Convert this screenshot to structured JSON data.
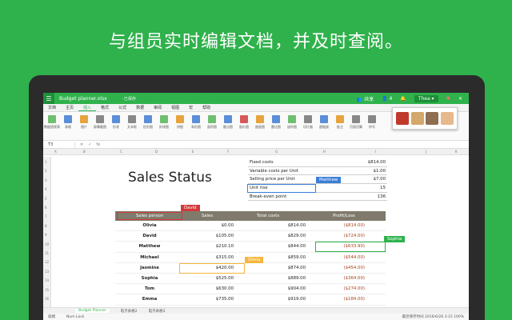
{
  "headline": "与组员实时编辑文档，并及时查阅。",
  "titlebar": {
    "file_name": "Budget planner.xlsx",
    "status": "· 已保存",
    "share": "共享",
    "users": "4",
    "user_name": "Thea ▾"
  },
  "menu": [
    "文档",
    "主页",
    "插入",
    "格式",
    "公式",
    "数据",
    "审阅",
    "视图",
    "宏",
    "帮助"
  ],
  "ribbon": [
    {
      "label": "数据透视表",
      "color": "g"
    },
    {
      "label": "表格",
      "color": "b"
    },
    {
      "label": "图片",
      "color": "o"
    },
    {
      "label": "屏幕截图",
      "color": "k"
    },
    {
      "label": "形状",
      "color": "b"
    },
    {
      "label": "文本框",
      "color": "k"
    },
    {
      "label": "柱形图",
      "color": "b"
    },
    {
      "label": "折线图",
      "color": "g"
    },
    {
      "label": "饼图",
      "color": "o"
    },
    {
      "label": "条形图",
      "color": "b"
    },
    {
      "label": "面积图",
      "color": "g"
    },
    {
      "label": "散点图",
      "color": "b"
    },
    {
      "label": "股价图",
      "color": "r"
    },
    {
      "label": "曲面图",
      "color": "o"
    },
    {
      "label": "雷达图",
      "color": "b"
    },
    {
      "label": "迷你图",
      "color": "g"
    },
    {
      "label": "切片器",
      "color": "k"
    },
    {
      "label": "超链接",
      "color": "b"
    },
    {
      "label": "批注",
      "color": "o"
    },
    {
      "label": "页眉页脚",
      "color": "k"
    },
    {
      "label": "符号",
      "color": "k"
    }
  ],
  "formula": {
    "cell": "T3",
    "fx": "fx"
  },
  "columns": [
    "A",
    "B",
    "C",
    "D",
    "E",
    "F",
    "G",
    "H",
    "I",
    "J",
    "K"
  ],
  "rows": [
    "1",
    "2",
    "3",
    "4",
    "5",
    "6",
    "7",
    "8",
    "9",
    "10",
    "11",
    "12",
    "13",
    "14",
    "15",
    "16"
  ],
  "title": "Sales Status",
  "kv": [
    {
      "label": "Fixed costs",
      "value": "$814.00"
    },
    {
      "label": "Variable costs per Unit",
      "value": "$1.00"
    },
    {
      "label": "Selling price per Unit",
      "value": "$7.00"
    },
    {
      "label": "Unit rise",
      "value": "15"
    },
    {
      "label": "Break-even point",
      "value": "136"
    }
  ],
  "table": {
    "headers": [
      "Sales person",
      "Sales",
      "Total costs",
      "Profit/Loss"
    ],
    "rows": [
      [
        "Olivia",
        "$0.00",
        "$814.00",
        "($814.00)"
      ],
      [
        "David",
        "$105.00",
        "$829.00",
        "($724.00)"
      ],
      [
        "Matthew",
        "$210.10",
        "$844.00",
        "($633.90)"
      ],
      [
        "Michael",
        "$315.00",
        "$859.00",
        "($544.00)"
      ],
      [
        "Jasmine",
        "$420.00",
        "$874.00",
        "($454.00)"
      ],
      [
        "Sophia",
        "$525.00",
        "$889.00",
        "($364.00)"
      ],
      [
        "Tom",
        "$630.00",
        "$904.00",
        "($274.00)"
      ],
      [
        "Emma",
        "$735.00",
        "$919.00",
        "($184.00)"
      ]
    ]
  },
  "collaborators": {
    "david": "David",
    "matthew": "Matthew",
    "sophia": "Sophia",
    "olivia": "Olivia"
  },
  "sheet_tabs": [
    "Budget Planner",
    "电子表格2",
    "电子表格3"
  ],
  "status": {
    "left": "就绪",
    "mode": "Num Lock",
    "right": "最近保存时间 2016/6/28 3:15  100%"
  },
  "colors": {
    "brand": "#2fb24c",
    "david": "#d23a3a",
    "matthew": "#3b7ed8",
    "sophia": "#2fb24c",
    "olivia": "#f4b73b"
  }
}
